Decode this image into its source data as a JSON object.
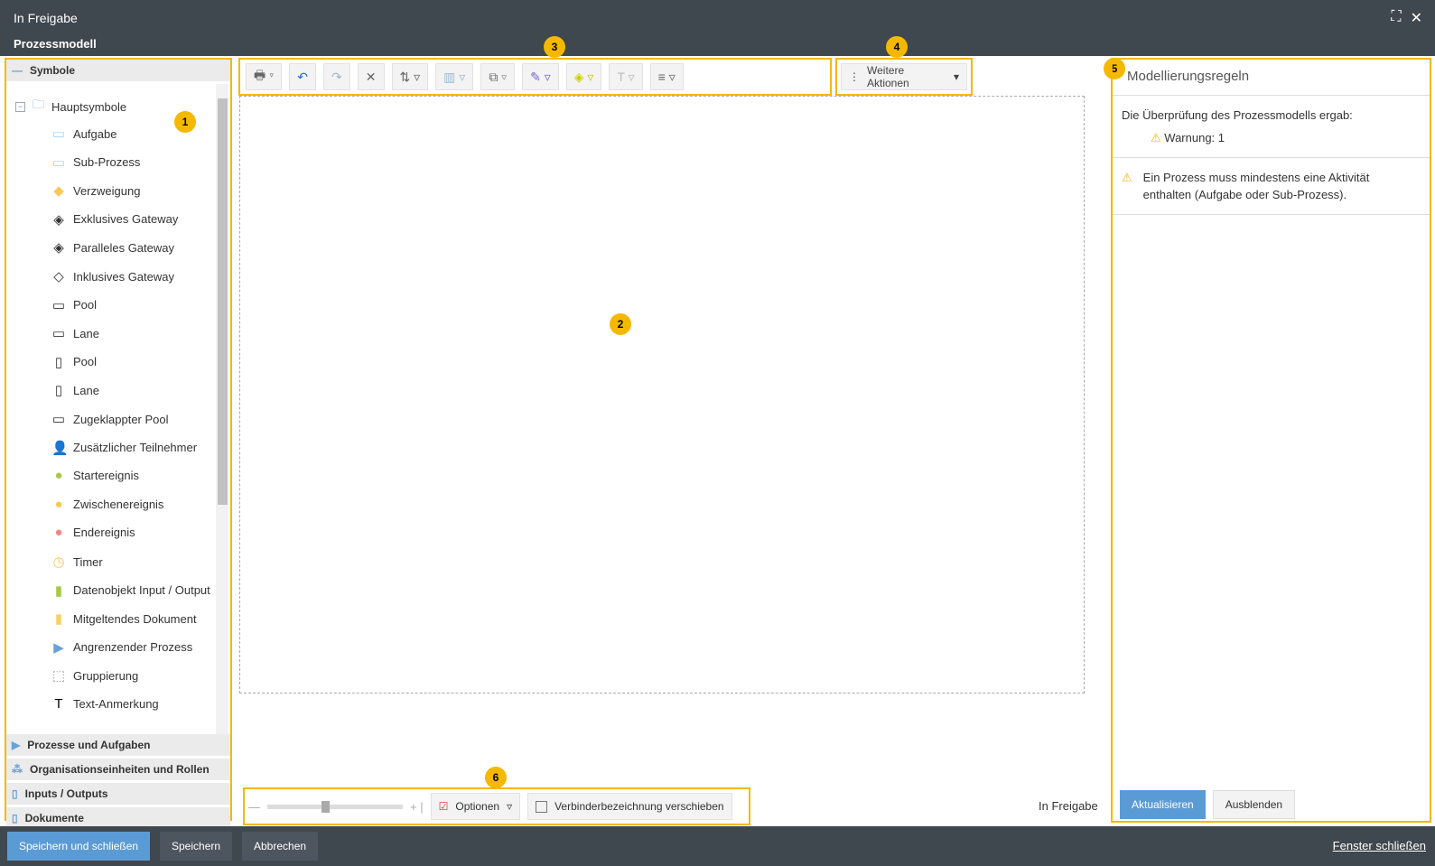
{
  "window": {
    "title": "In Freigabe",
    "subtitle": "Prozessmodell"
  },
  "left": {
    "section_title": "Symbole",
    "group": "Hauptsymbole",
    "items": [
      "Aufgabe",
      "Sub-Prozess",
      "Verzweigung",
      "Exklusives Gateway",
      "Paralleles Gateway",
      "Inklusives Gateway",
      "Pool",
      "Lane",
      "Pool",
      "Lane",
      "Zugeklappter Pool",
      "Zusätzlicher Teilnehmer",
      "Startereignis",
      "Zwischenereignis",
      "Endereignis",
      "Timer",
      "Datenobjekt Input / Output",
      "Mitgeltendes Dokument",
      "Angrenzender Prozess",
      "Gruppierung",
      "Text-Anmerkung"
    ],
    "sections": [
      "Prozesse und Aufgaben",
      "Organisationseinheiten und Rollen",
      "Inputs / Outputs",
      "Dokumente"
    ]
  },
  "toolbar": {
    "more_actions": "Weitere Aktionen"
  },
  "badges": [
    "1",
    "2",
    "3",
    "4",
    "5",
    "6"
  ],
  "bottom": {
    "options": "Optionen",
    "move_label": "Verbinderbezeichnung verschieben",
    "status": "In Freigabe",
    "zoom_percent": 40
  },
  "rules": {
    "title": "Modellierungsregeln",
    "result": "Die Überprüfung des Prozessmodells ergab:",
    "warning_count": "Warnung: 1",
    "message": "Ein Prozess muss mindestens eine Aktivität enthalten (Aufgabe oder Sub-Prozess).",
    "refresh": "Aktualisieren",
    "hide": "Ausblenden"
  },
  "footer": {
    "save_close": "Speichern und schließen",
    "save": "Speichern",
    "cancel": "Abbrechen",
    "close_window": "Fenster schließen"
  }
}
